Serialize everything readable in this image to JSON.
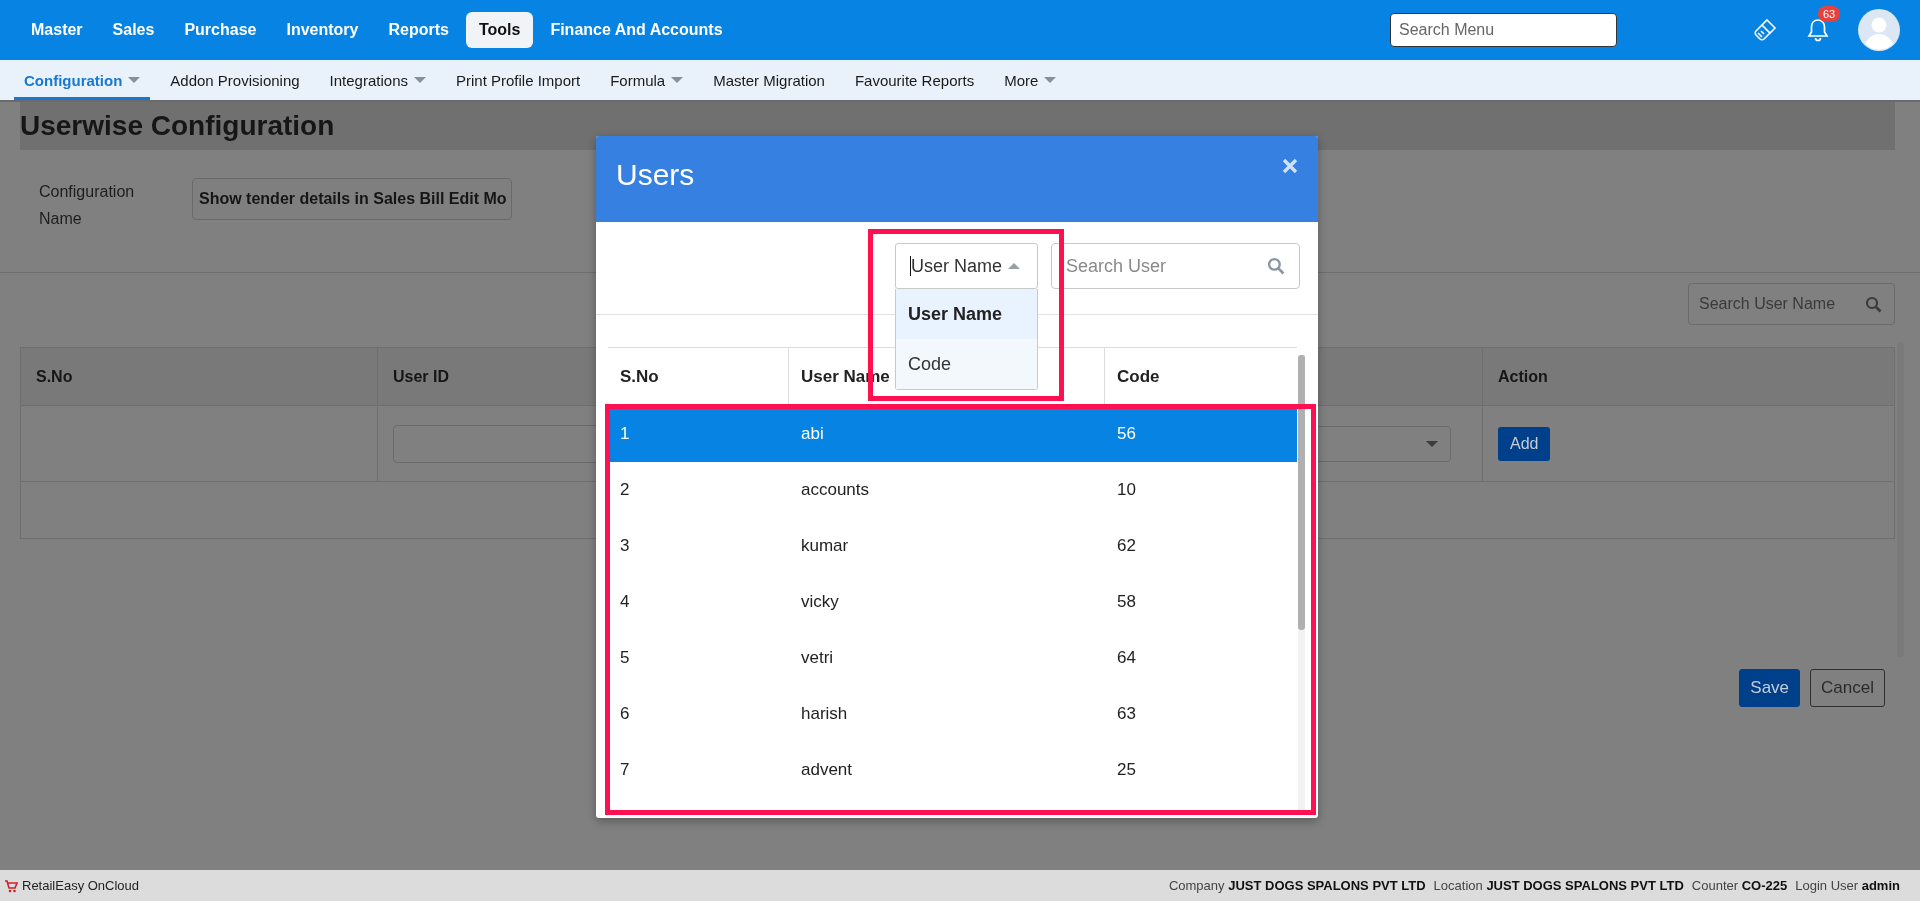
{
  "top_menu": [
    {
      "label": "Master",
      "selected": false
    },
    {
      "label": "Sales",
      "selected": false
    },
    {
      "label": "Purchase",
      "selected": false
    },
    {
      "label": "Inventory",
      "selected": false
    },
    {
      "label": "Reports",
      "selected": false
    },
    {
      "label": "Tools",
      "selected": true
    },
    {
      "label": "Finance And Accounts",
      "selected": false
    }
  ],
  "search_menu": {
    "placeholder": "Search Menu"
  },
  "notifications": {
    "badge": "63"
  },
  "sub_menu": [
    {
      "label": "Configuration",
      "selected": true,
      "dropdown": true
    },
    {
      "label": "Addon Provisioning",
      "selected": false,
      "dropdown": false
    },
    {
      "label": "Integrations",
      "selected": false,
      "dropdown": true
    },
    {
      "label": "Print Profile Import",
      "selected": false,
      "dropdown": false
    },
    {
      "label": "Formula",
      "selected": false,
      "dropdown": true
    },
    {
      "label": "Master Migration",
      "selected": false,
      "dropdown": false
    },
    {
      "label": "Favourite Reports",
      "selected": false,
      "dropdown": false
    },
    {
      "label": "More",
      "selected": false,
      "dropdown": true
    }
  ],
  "page": {
    "title": "Userwise Configuration",
    "configuration_name": {
      "label": "Configuration Name",
      "value": "Show tender details in Sales Bill Edit Mo"
    },
    "search": {
      "placeholder": "Search User Name"
    },
    "table": {
      "columns": [
        "S.No",
        "User ID",
        "Action"
      ],
      "add_button": "Add"
    },
    "buttons": [
      {
        "label": "Save",
        "kind": "primary"
      },
      {
        "label": "Cancel",
        "kind": "secondary"
      }
    ]
  },
  "modal": {
    "title": "Users",
    "filter": {
      "value": "User Name",
      "expanded": true,
      "options": [
        {
          "label": "User Name",
          "selected": true
        },
        {
          "label": "Code",
          "selected": false
        }
      ]
    },
    "search": {
      "placeholder": "Search User"
    },
    "table": {
      "columns": [
        "S.No",
        "User Name",
        "Code"
      ],
      "rows": [
        {
          "cells": [
            "1",
            "abi",
            "56"
          ],
          "selected": true
        },
        {
          "cells": [
            "2",
            "accounts",
            "10"
          ],
          "selected": false
        },
        {
          "cells": [
            "3",
            "kumar",
            "62"
          ],
          "selected": false
        },
        {
          "cells": [
            "4",
            "vicky",
            "58"
          ],
          "selected": false
        },
        {
          "cells": [
            "5",
            "vetri",
            "64"
          ],
          "selected": false
        },
        {
          "cells": [
            "6",
            "harish",
            "63"
          ],
          "selected": false
        },
        {
          "cells": [
            "7",
            "advent",
            "25"
          ],
          "selected": false
        }
      ]
    }
  },
  "status_bar": {
    "app_name": "RetailEasy OnCloud",
    "fields": [
      {
        "label": "Company",
        "value": "JUST DOGS SPALONS PVT LTD"
      },
      {
        "label": "Location",
        "value": "JUST DOGS SPALONS PVT LTD"
      },
      {
        "label": "Counter",
        "value": "CO-225"
      },
      {
        "label": "Login User",
        "value": "admin"
      }
    ]
  }
}
